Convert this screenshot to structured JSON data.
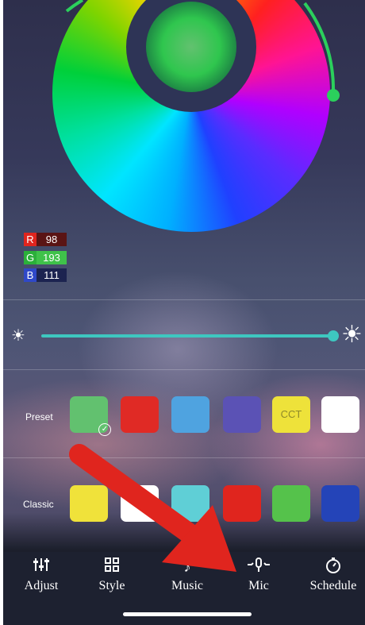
{
  "rgb": {
    "r_label": "R",
    "r_value": "98",
    "g_label": "G",
    "g_value": "193",
    "b_label": "B",
    "b_value": "111"
  },
  "colors": {
    "selected": "#62c16f",
    "accent": "#3ec7c0",
    "annotation_arrow": "#e0251e",
    "tab_bar": "#1d2130"
  },
  "brightness": {
    "level": 0.99,
    "min_icon": "sun-small-icon",
    "max_icon": "sun-large-icon"
  },
  "preset": {
    "label": "Preset",
    "swatches": [
      {
        "color": "#62c16f",
        "text": "",
        "selected": true
      },
      {
        "color": "#e02a25",
        "text": ""
      },
      {
        "color": "#4fa3e0",
        "text": ""
      },
      {
        "color": "#5b52b5",
        "text": ""
      },
      {
        "color": "#eee23a",
        "text": "CCT"
      },
      {
        "color": "#ffffff",
        "text": ""
      }
    ]
  },
  "classic": {
    "label": "Classic",
    "swatches": [
      {
        "color": "#f0e23a"
      },
      {
        "color": "#ffffff"
      },
      {
        "color": "#5fcfd6"
      },
      {
        "color": "#e0251e"
      },
      {
        "color": "#55c24b"
      },
      {
        "color": "#2444b8"
      }
    ]
  },
  "tabs": [
    {
      "label": "Adjust",
      "icon": "sliders-icon",
      "glyph": "⫶",
      "active": true
    },
    {
      "label": "Style",
      "icon": "grid-icon",
      "glyph": "▦",
      "active": false
    },
    {
      "label": "Music",
      "icon": "music-icon",
      "glyph": "♪",
      "active": false
    },
    {
      "label": "Mic",
      "icon": "mic-icon",
      "glyph": "🎙",
      "active": false
    },
    {
      "label": "Schedule",
      "icon": "timer-icon",
      "glyph": "⏱",
      "active": false
    }
  ]
}
